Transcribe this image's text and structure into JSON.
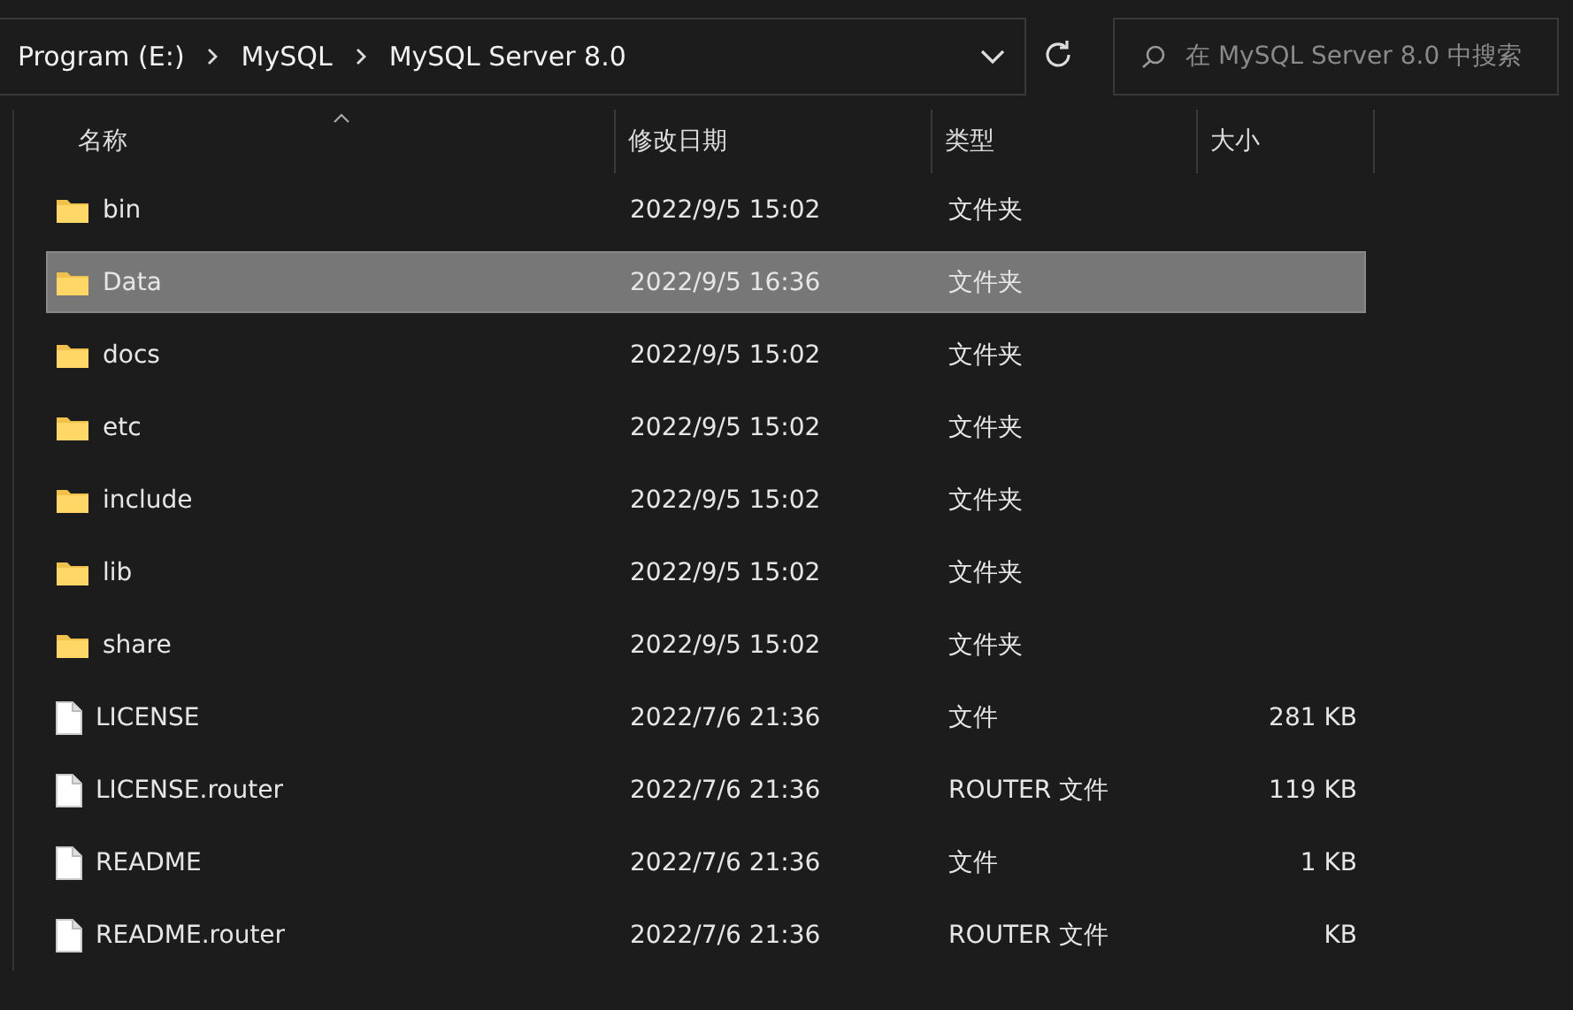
{
  "address_bar": {
    "crumbs": [
      "Program (E:)",
      "MySQL",
      "MySQL Server 8.0"
    ]
  },
  "search": {
    "placeholder": "在 MySQL Server 8.0 中搜索"
  },
  "table": {
    "columns": [
      "名称",
      "修改日期",
      "类型",
      "大小"
    ],
    "rows": [
      {
        "kind": "folder",
        "name": "bin",
        "date": "2022/9/5 15:02",
        "type": "文件夹",
        "selected": false
      },
      {
        "kind": "folder",
        "name": "Data",
        "date": "2022/9/5 16:36",
        "type": "文件夹",
        "selected": true
      },
      {
        "kind": "folder",
        "name": "docs",
        "date": "2022/9/5 15:02",
        "type": "文件夹",
        "selected": false
      },
      {
        "kind": "folder",
        "name": "etc",
        "date": "2022/9/5 15:02",
        "type": "文件夹",
        "selected": false
      },
      {
        "kind": "folder",
        "name": "include",
        "date": "2022/9/5 15:02",
        "type": "文件夹",
        "selected": false
      },
      {
        "kind": "folder",
        "name": "lib",
        "date": "2022/9/5 15:02",
        "type": "文件夹",
        "selected": false
      },
      {
        "kind": "folder",
        "name": "share",
        "date": "2022/9/5 15:02",
        "type": "文件夹",
        "selected": false
      },
      {
        "kind": "file",
        "name": "LICENSE",
        "date": "2022/7/6 21:36",
        "type": "文件",
        "size": "281 KB",
        "selected": false
      },
      {
        "kind": "file",
        "name": "LICENSE.router",
        "date": "2022/7/6 21:36",
        "type": "ROUTER 文件",
        "size": "119 KB",
        "selected": false
      },
      {
        "kind": "file",
        "name": "README",
        "date": "2022/7/6 21:36",
        "type": "文件",
        "size": "1 KB",
        "selected": false
      },
      {
        "kind": "file",
        "name": "README.router",
        "date": "2022/7/6 21:36",
        "type": "ROUTER 文件",
        "size": "KB",
        "selected": false
      }
    ]
  }
}
